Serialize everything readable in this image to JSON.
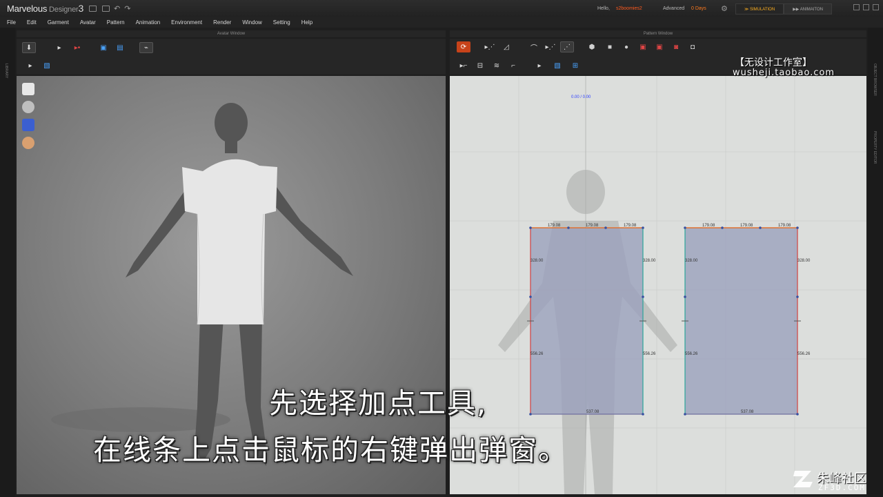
{
  "app": {
    "title_main": "Marvelous",
    "title_sub": " Designer",
    "title_ver": "3",
    "hello_label": "Hello,",
    "username": "s2boomies2",
    "advanced_label": "Advanced",
    "days_left": "0 Days",
    "mode_tabs": [
      "SIMULATION",
      "ANIMAITON"
    ]
  },
  "menu": [
    "File",
    "Edit",
    "Garment",
    "Avatar",
    "Pattern",
    "Animation",
    "Environment",
    "Render",
    "Window",
    "Setting",
    "Help"
  ],
  "side_labels": {
    "left": "LIBRARY",
    "right_top": "OBJECT BROWSER",
    "right_bottom": "PROPERTY EDITOR"
  },
  "panels": {
    "avatar_title": "Avatar Window",
    "pattern_title": "Pattern Window",
    "pattern_coord": "0.00 / 0.00"
  },
  "pattern_measurements": {
    "top": [
      "179.08",
      "179.08",
      "179.08",
      "179.08",
      "179.08",
      "179.08"
    ],
    "upper_side": [
      "328.00",
      "328.00",
      "328.00",
      "328.00"
    ],
    "lower_side": [
      "556.26",
      "556.26",
      "556.26",
      "556.26"
    ],
    "bottom": [
      "537.08",
      "537.08"
    ]
  },
  "subtitles": {
    "line1": "先选择加点工具,",
    "line2": "在线条上点击鼠标的右键弹出弹窗。"
  },
  "watermark": {
    "cn": "【无设计工作室】",
    "url": "wusheji.taobao.com"
  },
  "logo": {
    "cn": "朱峰社区",
    "en": "ZF3D.COM"
  },
  "colors": {
    "accent_orange": "#ff5a1e",
    "mode_active": "#ffb020",
    "pattern_fill": "#9aa0bc",
    "seam_red": "#d04040",
    "seam_teal": "#2aa69a"
  }
}
